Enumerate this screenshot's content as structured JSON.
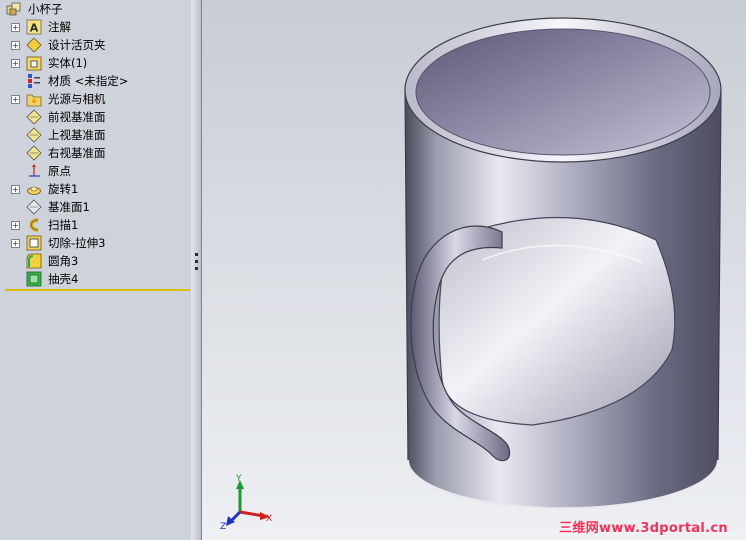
{
  "tree": {
    "root_label": "小杯子",
    "items": [
      {
        "label": "注解",
        "icon": "annotation-icon",
        "expandable": true
      },
      {
        "label": "设计活页夹",
        "icon": "design-binder-icon",
        "expandable": true
      },
      {
        "label": "实体(1)",
        "icon": "solid-bodies-icon",
        "expandable": true
      },
      {
        "label": "材质 <未指定>",
        "icon": "material-icon",
        "expandable": false
      },
      {
        "label": "光源与相机",
        "icon": "lights-cameras-icon",
        "expandable": true
      },
      {
        "label": "前视基准面",
        "icon": "plane-icon",
        "expandable": false
      },
      {
        "label": "上视基准面",
        "icon": "plane-icon",
        "expandable": false
      },
      {
        "label": "右视基准面",
        "icon": "plane-icon",
        "expandable": false
      },
      {
        "label": "原点",
        "icon": "origin-icon",
        "expandable": false
      },
      {
        "label": "旋转1",
        "icon": "revolve-icon",
        "expandable": true
      },
      {
        "label": "基准面1",
        "icon": "plane-icon",
        "expandable": false
      },
      {
        "label": "扫描1",
        "icon": "sweep-icon",
        "expandable": true
      },
      {
        "label": "切除-拉伸3",
        "icon": "cut-extrude-icon",
        "expandable": true
      },
      {
        "label": "圆角3",
        "icon": "fillet-icon",
        "expandable": false
      },
      {
        "label": "抽壳4",
        "icon": "shell-icon",
        "expandable": false
      }
    ],
    "expander_symbol": "+"
  },
  "triad": {
    "x_label": "X",
    "y_label": "Y",
    "z_label": "Z"
  },
  "watermark": "三维网www.3dportal.cn",
  "colors": {
    "panel_bg": "#ced2da",
    "rollback_bar": "#d9c100",
    "watermark": "#ff2d55",
    "triad_x": "#d21e1e",
    "triad_y": "#1d9a2a",
    "triad_z": "#2230c8"
  }
}
